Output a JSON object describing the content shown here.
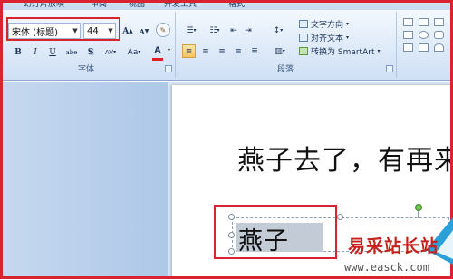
{
  "ribbon": {
    "tabs": [
      "幻灯片放映",
      "审阅",
      "视图",
      "开发工具",
      "格式"
    ],
    "font_group": {
      "label": "字体",
      "font_name": "宋体 (标题)",
      "font_size": "44",
      "grow_font": "A",
      "shrink_font": "A",
      "bold": "B",
      "italic": "I",
      "underline": "U",
      "strikethrough": "abe",
      "shadow": "S",
      "char_spacing": "AV",
      "change_case": "Aa",
      "font_color": "A"
    },
    "paragraph_group": {
      "label": "段落",
      "text_direction": "文字方向",
      "align_text": "对齐文本",
      "convert_smartart": "转换为 SmartArt"
    }
  },
  "slide": {
    "title_text": "燕子去了，有再来",
    "selected_text": "燕子"
  },
  "watermark": {
    "site_name": "易采站长站",
    "url": "www.easck.com"
  },
  "colors": {
    "highlight_frame": "#d9232e",
    "font_color_bar": "#e02020",
    "active_align": "#f7c35a"
  }
}
